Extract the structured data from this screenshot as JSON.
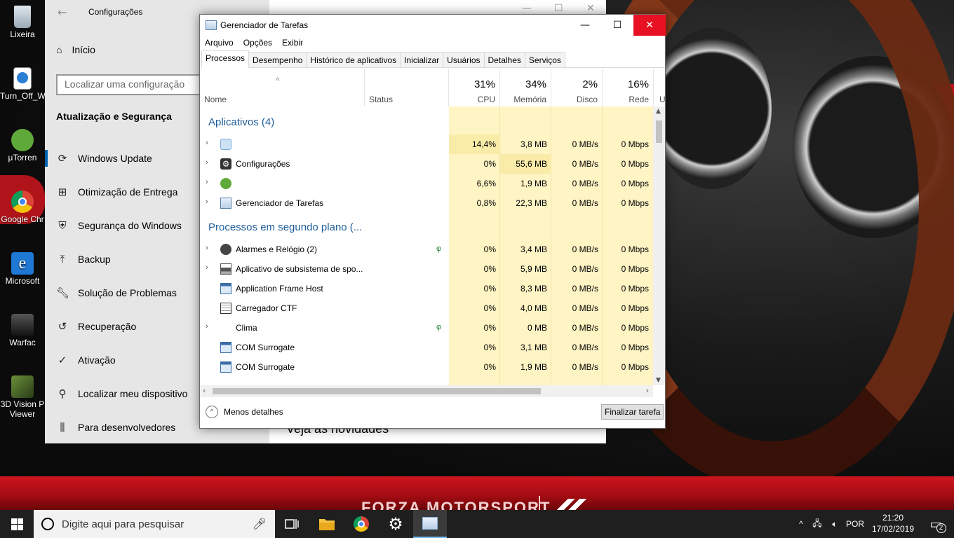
{
  "desktop": {
    "icons": [
      {
        "label": "Lixeira"
      },
      {
        "label": "Turn_Off_W"
      },
      {
        "label": "μTorren"
      },
      {
        "label": "Google Chr"
      },
      {
        "label": "Microsoft"
      },
      {
        "label": "Warfac"
      },
      {
        "label": "3D Vision P"
      },
      {
        "label": "Viewer"
      }
    ],
    "wallpaper_band_text": "FORZA MOTORSPORT"
  },
  "settings": {
    "window_title": "Configurações",
    "home_label": "Início",
    "search_placeholder": "Localizar uma configuração",
    "section_title": "Atualização e Segurança",
    "nav_items": [
      {
        "label": "Windows Update",
        "icon": "refresh-icon"
      },
      {
        "label": "Otimização de Entrega",
        "icon": "delivery-icon"
      },
      {
        "label": "Segurança do Windows",
        "icon": "shield-icon"
      },
      {
        "label": "Backup",
        "icon": "backup-icon"
      },
      {
        "label": "Solução de Problemas",
        "icon": "wrench-icon"
      },
      {
        "label": "Recuperação",
        "icon": "history-icon"
      },
      {
        "label": "Ativação",
        "icon": "check-circle-icon"
      },
      {
        "label": "Localizar meu dispositivo",
        "icon": "person-pin-icon"
      },
      {
        "label": "Para desenvolvedores",
        "icon": "sliders-icon"
      }
    ],
    "content_bottom_text": "Veja as novidades"
  },
  "taskmgr": {
    "title": "Gerenciador de Tarefas",
    "menu": [
      "Arquivo",
      "Opções",
      "Exibir"
    ],
    "tabs": [
      "Processos",
      "Desempenho",
      "Histórico de aplicativos",
      "Inicializar",
      "Usuários",
      "Detalhes",
      "Serviços"
    ],
    "columns": {
      "name": "Nome",
      "status": "Status",
      "cpu": {
        "pct": "31%",
        "label": "CPU"
      },
      "memory": {
        "pct": "34%",
        "label": "Memória"
      },
      "disk": {
        "pct": "2%",
        "label": "Disco"
      },
      "network": {
        "pct": "16%",
        "label": "Rede"
      },
      "extra": "U"
    },
    "groups": {
      "apps": "Aplicativos (4)",
      "background": "Processos em segundo plano (..."
    },
    "rows": [
      {
        "name": "",
        "cpu": "14,4%",
        "mem": "3,8 MB",
        "disk": "0 MB/s",
        "net": "0 Mbps"
      },
      {
        "name": "Configurações",
        "cpu": "0%",
        "mem": "55,6 MB",
        "disk": "0 MB/s",
        "net": "0 Mbps"
      },
      {
        "name": "",
        "cpu": "6,6%",
        "mem": "1,9 MB",
        "disk": "0 MB/s",
        "net": "0 Mbps"
      },
      {
        "name": "Gerenciador de Tarefas",
        "cpu": "0,8%",
        "mem": "22,3 MB",
        "disk": "0 MB/s",
        "net": "0 Mbps"
      },
      {
        "name": "Alarmes e Relógio (2)",
        "cpu": "0%",
        "mem": "3,4 MB",
        "disk": "0 MB/s",
        "net": "0 Mbps"
      },
      {
        "name": "Aplicativo de subsistema de spo...",
        "cpu": "0%",
        "mem": "5,9 MB",
        "disk": "0 MB/s",
        "net": "0 Mbps"
      },
      {
        "name": "Application Frame Host",
        "cpu": "0%",
        "mem": "8,3 MB",
        "disk": "0 MB/s",
        "net": "0 Mbps"
      },
      {
        "name": "Carregador CTF",
        "cpu": "0%",
        "mem": "4,0 MB",
        "disk": "0 MB/s",
        "net": "0 Mbps"
      },
      {
        "name": "Clima",
        "cpu": "0%",
        "mem": "0 MB",
        "disk": "0 MB/s",
        "net": "0 Mbps"
      },
      {
        "name": "COM Surrogate",
        "cpu": "0%",
        "mem": "3,1 MB",
        "disk": "0 MB/s",
        "net": "0 Mbps"
      },
      {
        "name": "COM Surrogate",
        "cpu": "0%",
        "mem": "1,9 MB",
        "disk": "0 MB/s",
        "net": "0 Mbps"
      }
    ],
    "less_details": "Menos detalhes",
    "end_task": "Finalizar tarefa"
  },
  "taskbar": {
    "search_placeholder": "Digite aqui para pesquisar",
    "language": "POR",
    "time": "21:20",
    "date": "17/02/2019",
    "notifications": "2"
  },
  "colors": {
    "accent": "#0063b1",
    "close_red": "#e81123",
    "heat_yellow": "#fff4c4",
    "heat_yellow_strong": "#f9eba8",
    "group_blue": "#1f5e9a"
  }
}
